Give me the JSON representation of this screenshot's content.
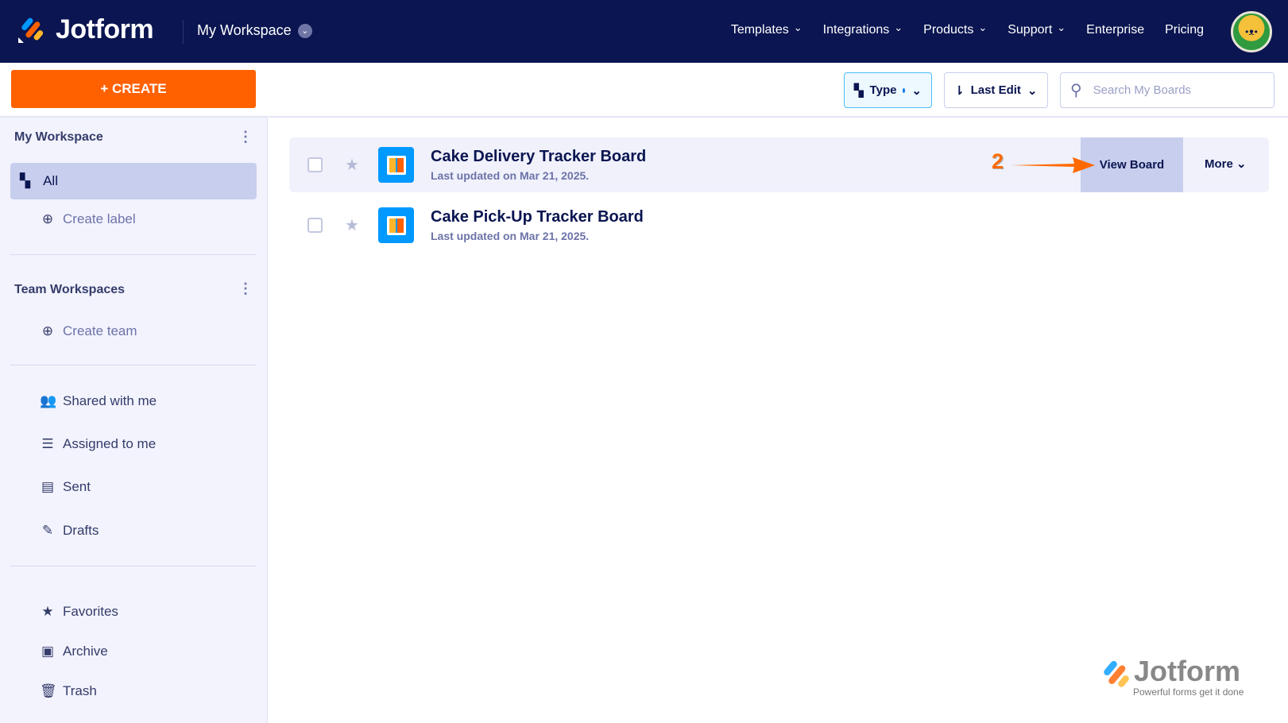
{
  "header": {
    "logo": "Jotform",
    "workspace": "My Workspace",
    "nav": [
      "Templates",
      "Integrations",
      "Products",
      "Support",
      "Enterprise",
      "Pricing"
    ]
  },
  "sidebar": {
    "create_label": "+ CREATE",
    "my_workspace": "My Workspace",
    "all": "All",
    "create_label_link": "Create label",
    "team_workspaces": "Team Workspaces",
    "create_team": "Create team",
    "items": [
      {
        "label": "Shared with me",
        "icon": "users-icon"
      },
      {
        "label": "Assigned to me",
        "icon": "list-icon"
      },
      {
        "label": "Sent",
        "icon": "message-icon"
      },
      {
        "label": "Drafts",
        "icon": "draft-icon"
      }
    ],
    "bottom": [
      {
        "label": "Favorites",
        "icon": "star-icon"
      },
      {
        "label": "Archive",
        "icon": "archive-icon"
      },
      {
        "label": "Trash",
        "icon": "trash-icon"
      }
    ]
  },
  "toolbar": {
    "type": "Type",
    "sort": "Last Edit",
    "search_placeholder": "Search My Boards"
  },
  "boards": [
    {
      "title": "Cake Delivery Tracker Board",
      "updated": "Last updated on Mar 21, 2025."
    },
    {
      "title": "Cake Pick-Up Tracker Board",
      "updated": "Last updated on Mar 21, 2025."
    }
  ],
  "row_actions": {
    "view": "View Board",
    "more": "More"
  },
  "annotation": "2",
  "watermark": {
    "brand": "Jotform",
    "tagline": "Powerful forms get it done"
  },
  "colors": {
    "header": "#0a1551",
    "accent": "#ff6100",
    "highlight": "#c8ceed"
  }
}
